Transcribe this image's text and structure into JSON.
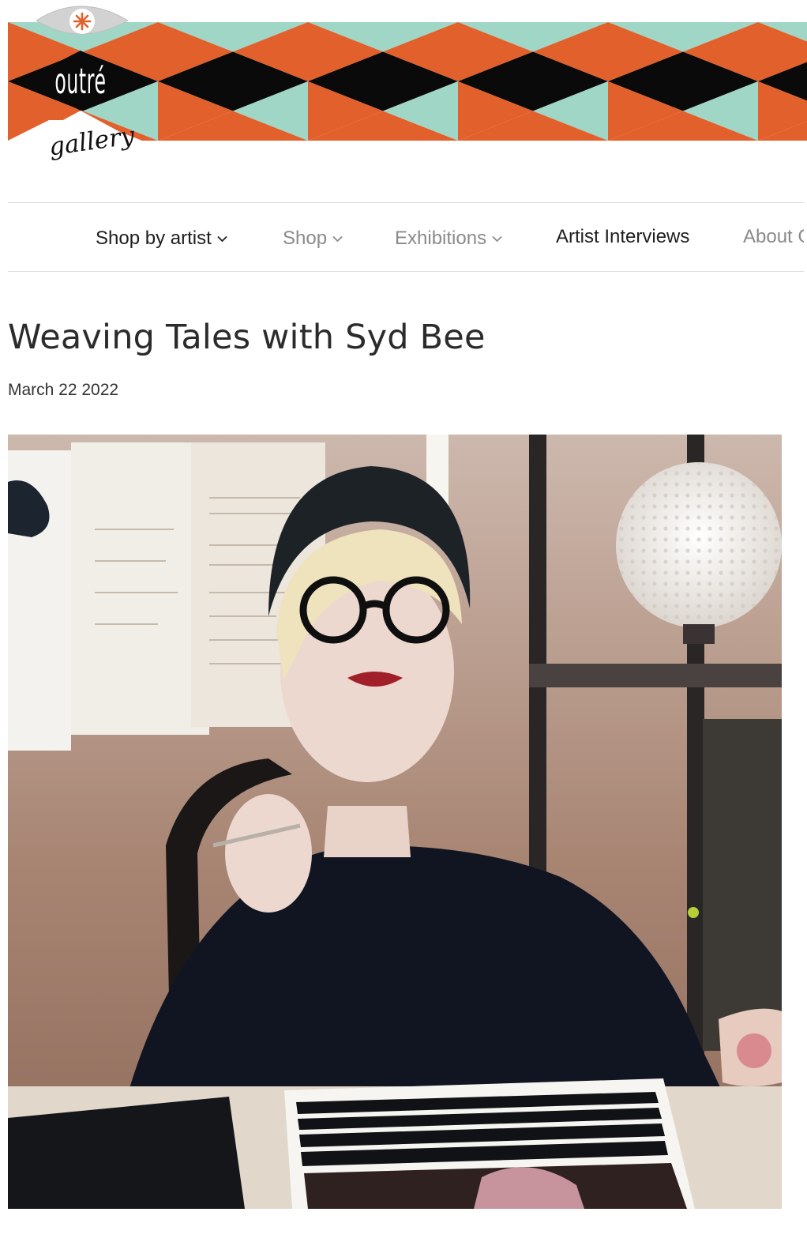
{
  "brand": {
    "logo_word": "outré",
    "logo_script": "gallery",
    "colors": {
      "orange": "#e2602c",
      "mint": "#9fd6c6",
      "black": "#0a0a0a"
    }
  },
  "nav": {
    "items": [
      {
        "label": "Shop by artist",
        "has_dropdown": true,
        "style": "dark"
      },
      {
        "label": "Shop",
        "has_dropdown": true,
        "style": "muted"
      },
      {
        "label": "Exhibitions",
        "has_dropdown": true,
        "style": "muted"
      },
      {
        "label": "Artist Interviews",
        "has_dropdown": false,
        "style": "dark"
      },
      {
        "label": "About C",
        "has_dropdown": false,
        "style": "muted"
      }
    ],
    "dropdown_icon": "chevron-down-icon"
  },
  "article": {
    "title": "Weaving Tales with Syd Bee",
    "date": "March 22 2022"
  }
}
